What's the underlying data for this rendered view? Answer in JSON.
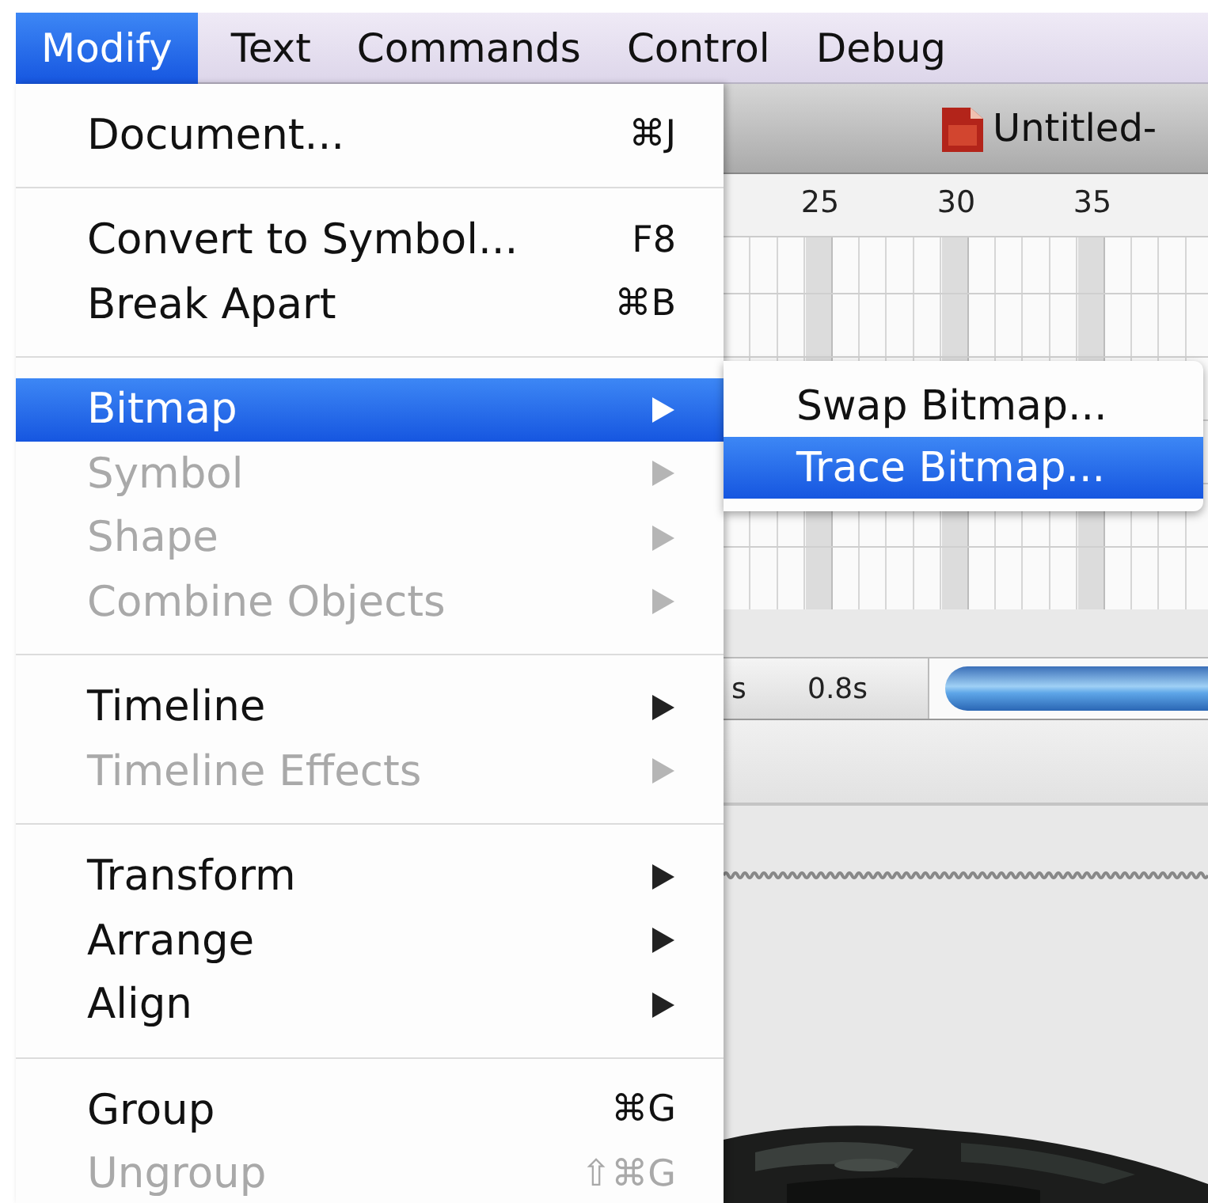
{
  "menubar": {
    "items": [
      {
        "label": "Modify",
        "selected": true
      },
      {
        "label": "Text",
        "selected": false
      },
      {
        "label": "Commands",
        "selected": false
      },
      {
        "label": "Control",
        "selected": false
      },
      {
        "label": "Debug",
        "selected": false
      }
    ]
  },
  "menu": {
    "items": [
      {
        "kind": "item",
        "label": "Document...",
        "shortcut": "⌘J",
        "disabled": false,
        "submenu": false,
        "selected": false
      },
      {
        "kind": "separator"
      },
      {
        "kind": "item",
        "label": "Convert to Symbol...",
        "shortcut": "F8",
        "disabled": false,
        "submenu": false,
        "selected": false
      },
      {
        "kind": "item",
        "label": "Break Apart",
        "shortcut": "⌘B",
        "disabled": false,
        "submenu": false,
        "selected": false
      },
      {
        "kind": "separator"
      },
      {
        "kind": "item",
        "label": "Bitmap",
        "disabled": false,
        "submenu": true,
        "selected": true
      },
      {
        "kind": "item",
        "label": "Symbol",
        "disabled": true,
        "submenu": true,
        "selected": false
      },
      {
        "kind": "item",
        "label": "Shape",
        "disabled": true,
        "submenu": true,
        "selected": false
      },
      {
        "kind": "item",
        "label": "Combine Objects",
        "disabled": true,
        "submenu": true,
        "selected": false
      },
      {
        "kind": "separator"
      },
      {
        "kind": "item",
        "label": "Timeline",
        "disabled": false,
        "submenu": true,
        "selected": false
      },
      {
        "kind": "item",
        "label": "Timeline Effects",
        "disabled": true,
        "submenu": true,
        "selected": false
      },
      {
        "kind": "separator"
      },
      {
        "kind": "item",
        "label": "Transform",
        "disabled": false,
        "submenu": true,
        "selected": false
      },
      {
        "kind": "item",
        "label": "Arrange",
        "disabled": false,
        "submenu": true,
        "selected": false
      },
      {
        "kind": "item",
        "label": "Align",
        "disabled": false,
        "submenu": true,
        "selected": false
      },
      {
        "kind": "separator"
      },
      {
        "kind": "item",
        "label": "Group",
        "shortcut": "⌘G",
        "disabled": false,
        "submenu": false,
        "selected": false
      },
      {
        "kind": "item",
        "label": "Ungroup",
        "shortcut": "⇧⌘G",
        "disabled": true,
        "submenu": false,
        "selected": false
      }
    ]
  },
  "submenu": {
    "items": [
      {
        "label": "Swap Bitmap...",
        "selected": false
      },
      {
        "label": "Trace Bitmap...",
        "selected": true
      }
    ]
  },
  "document": {
    "title": "Untitled-"
  },
  "timeline": {
    "ruler_labels": [
      "25",
      "30",
      "35"
    ],
    "status_1": "s",
    "status_2": "0.8s"
  }
}
